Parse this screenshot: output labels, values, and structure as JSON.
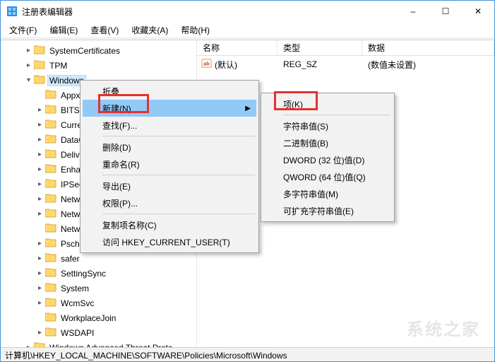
{
  "window": {
    "title": "注册表编辑器"
  },
  "menubar": {
    "file": "文件(F)",
    "edit": "编辑(E)",
    "view": "查看(V)",
    "favorites": "收藏夹(A)",
    "help": "帮助(H)"
  },
  "win_controls": {
    "min": "–",
    "max": "☐",
    "close": "✕"
  },
  "tree": {
    "nodes": [
      {
        "label": "SystemCertificates",
        "indent": 2,
        "expander": "▸"
      },
      {
        "label": "TPM",
        "indent": 2,
        "expander": "▸"
      },
      {
        "label": "Windows",
        "indent": 2,
        "expander": "▾",
        "selected": true
      },
      {
        "label": "Appx",
        "indent": 3,
        "expander": ""
      },
      {
        "label": "BITS",
        "indent": 3,
        "expander": "▸"
      },
      {
        "label": "Curre",
        "indent": 3,
        "expander": "▸"
      },
      {
        "label": "DataC",
        "indent": 3,
        "expander": "▸"
      },
      {
        "label": "Delive",
        "indent": 3,
        "expander": "▸"
      },
      {
        "label": "Enhan",
        "indent": 3,
        "expander": "▸"
      },
      {
        "label": "IPSec",
        "indent": 3,
        "expander": "▸"
      },
      {
        "label": "Netw",
        "indent": 3,
        "expander": "▸"
      },
      {
        "label": "Netw",
        "indent": 3,
        "expander": "▸"
      },
      {
        "label": "Netw",
        "indent": 3,
        "expander": ""
      },
      {
        "label": "Psche",
        "indent": 3,
        "expander": "▸"
      },
      {
        "label": "safer",
        "indent": 3,
        "expander": "▸"
      },
      {
        "label": "SettingSync",
        "indent": 3,
        "expander": "▸"
      },
      {
        "label": "System",
        "indent": 3,
        "expander": "▸"
      },
      {
        "label": "WcmSvc",
        "indent": 3,
        "expander": "▸"
      },
      {
        "label": "WorkplaceJoin",
        "indent": 3,
        "expander": ""
      },
      {
        "label": "WSDAPI",
        "indent": 3,
        "expander": "▸"
      },
      {
        "label": "Windows Advanced Threat Prote",
        "indent": 2,
        "expander": "▸"
      }
    ]
  },
  "list": {
    "columns": {
      "name": "名称",
      "type": "类型",
      "data": "数据"
    },
    "rows": [
      {
        "name": "(默认)",
        "type": "REG_SZ",
        "data": "(数值未设置)"
      }
    ]
  },
  "context_menu": {
    "collapse": "折叠",
    "new": "新建(N)",
    "find": "查找(F)...",
    "delete": "删除(D)",
    "rename": "重命名(R)",
    "export": "导出(E)",
    "permissions": "权限(P)...",
    "copy_key_name": "复制项名称(C)",
    "goto_hkcu": "访问 HKEY_CURRENT_USER(T)"
  },
  "submenu": {
    "key": "项(K)",
    "string": "字符串值(S)",
    "binary": "二进制值(B)",
    "dword": "DWORD (32 位)值(D)",
    "qword": "QWORD (64 位)值(Q)",
    "multi": "多字符串值(M)",
    "expand": "可扩充字符串值(E)"
  },
  "statusbar": {
    "path": "计算机\\HKEY_LOCAL_MACHINE\\SOFTWARE\\Policies\\Microsoft\\Windows"
  },
  "watermark": "系统之家"
}
